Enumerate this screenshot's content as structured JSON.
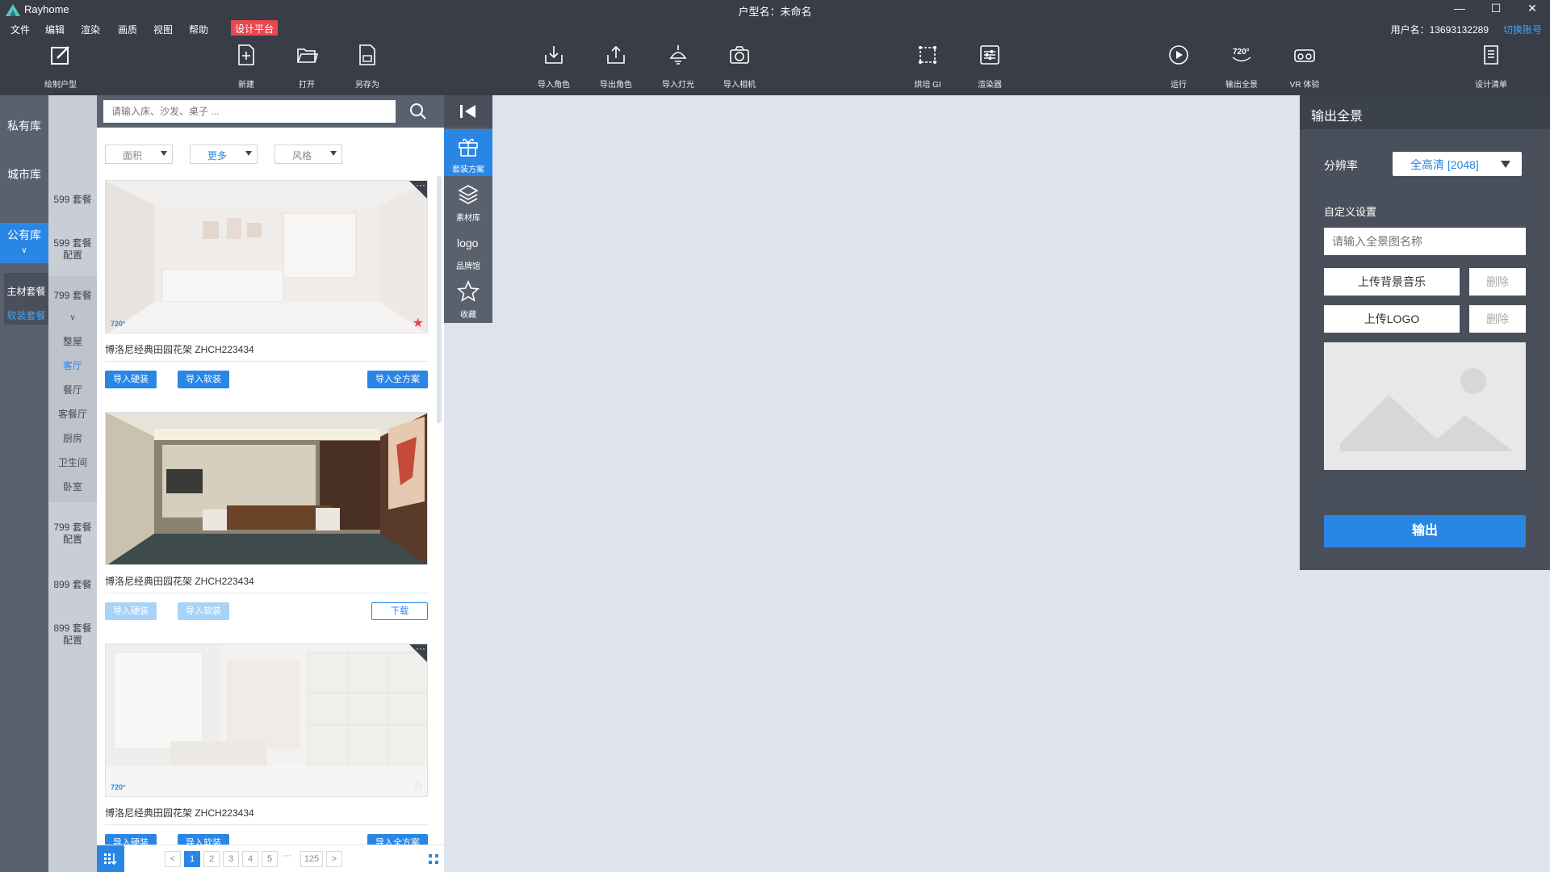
{
  "app": {
    "name": "Rayhome",
    "center_title": "户型名：未命名"
  },
  "window": {
    "minimize": "—",
    "maximize": "☐",
    "close": "✕"
  },
  "menu": {
    "items": [
      "文件",
      "编辑",
      "渲染",
      "画质",
      "视图",
      "帮助"
    ],
    "platform": "设计平台",
    "user": "用户名：13693132289",
    "switch_account": "切换账号"
  },
  "toolbar": {
    "draw": "绘制户型",
    "new": "新建",
    "open": "打开",
    "save_as": "另存为",
    "import_view": "导入角色",
    "export_view": "导出角色",
    "import_light": "导入灯光",
    "import_camera": "导入相机",
    "bake_gi": "烘培 GI",
    "renderer": "渲染器",
    "run": "运行",
    "export_panorama": "输出全景",
    "vr": "VR 体验",
    "design_list": "设计清单"
  },
  "library": {
    "tabs": [
      "私有库",
      "城市库",
      "公有库"
    ],
    "sub": [
      "主材套餐",
      "软装套餐"
    ]
  },
  "packages": {
    "items": [
      "599 套餐",
      "599 套餐\n配置",
      "799 套餐",
      "799 套餐\n配置",
      "899 套餐",
      "899 套餐\n配置"
    ],
    "rooms": [
      "整屋",
      "客厅",
      "餐厅",
      "客餐厅",
      "厨房",
      "卫生间",
      "卧室"
    ]
  },
  "search": {
    "placeholder": "请输入床、沙发、桌子 ..."
  },
  "filters": [
    "面积",
    "更多",
    "风格"
  ],
  "cards": [
    {
      "title": "博洛尼经典田园花架 ZHCH223434",
      "btn1": "导入硬装",
      "btn2": "导入软装",
      "btn3": "导入全方案",
      "badge": "720°"
    },
    {
      "title": "博洛尼经典田园花架 ZHCH223434",
      "btn1": "导入硬装",
      "btn2": "导入软装",
      "btn3": "下载"
    },
    {
      "title": "博洛尼经典田园花架 ZHCH223434",
      "btn1": "导入硬装",
      "btn2": "导入软装",
      "btn3": "导入全方案",
      "badge": "720°"
    }
  ],
  "pagination": {
    "prev": "<",
    "pages": [
      "1",
      "2",
      "3",
      "4",
      "5"
    ],
    "ellipsis": "···",
    "last": "125",
    "next": ">",
    "current": "1"
  },
  "rail": {
    "tabs": [
      "套装方案",
      "素材库",
      "品牌馆",
      "收藏"
    ]
  },
  "panel": {
    "title": "输出全景",
    "resolution_label": "分辨率",
    "resolution_value": "全高清 [2048]",
    "custom_label": "自定义设置",
    "name_placeholder": "请输入全景图名称",
    "upload_music": "上传背景音乐",
    "upload_logo": "上传LOGO",
    "delete": "删除",
    "output": "输出"
  },
  "colors": {
    "accent": "#2a86e5",
    "dark": "#383d47",
    "platform": "#e8484f"
  }
}
